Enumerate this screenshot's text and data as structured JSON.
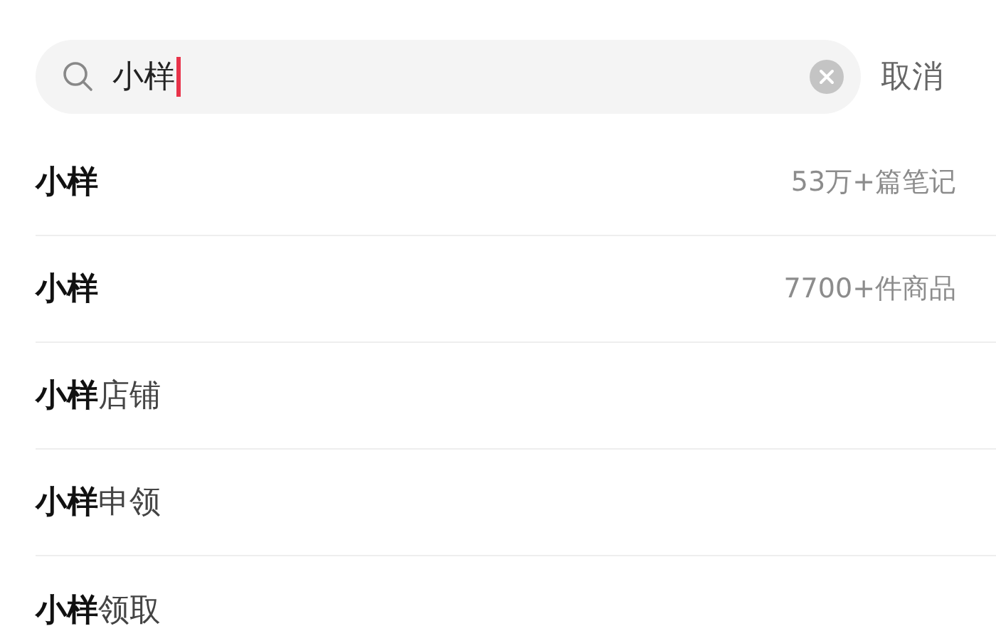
{
  "search": {
    "value": "小样",
    "cancel": "取消"
  },
  "suggestions": [
    {
      "text": "**小样**",
      "count": "53万+篇笔记"
    },
    {
      "text": "**小样**",
      "count": "7700+件商品"
    },
    {
      "text": "**小样**店铺"
    },
    {
      "text": "**小样**申领"
    },
    {
      "text": "**小样**领取"
    }
  ]
}
